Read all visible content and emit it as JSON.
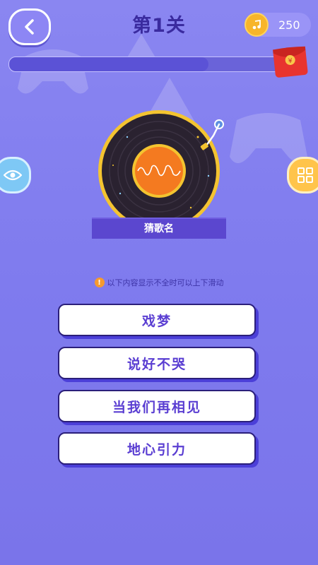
{
  "header": {
    "back_icon": "chevron-left-icon",
    "level_title": "第1关",
    "coin_icon": "coin-music-icon",
    "coin_count": "250"
  },
  "progress": {
    "fraction": 0.68,
    "reward_icon": "red-envelope-icon",
    "reward_symbol": "¥"
  },
  "side": {
    "left_icon": "eye-icon",
    "right_icon": "grid-icon"
  },
  "record": {
    "label": "猜歌名",
    "icon": "vinyl-record-icon"
  },
  "hint": {
    "icon": "exclamation-icon",
    "symbol": "!",
    "text": "以下内容显示不全时可以上下滑动"
  },
  "answers": [
    {
      "label": "戏梦"
    },
    {
      "label": "说好不哭"
    },
    {
      "label": "当我们再相见"
    },
    {
      "label": "地心引力"
    }
  ],
  "colors": {
    "accent": "#5a3ed2",
    "background": "#8a86f1",
    "coin": "#f7b52a",
    "eye_button": "#7ec8f5",
    "grid_button": "#ffc44b"
  }
}
